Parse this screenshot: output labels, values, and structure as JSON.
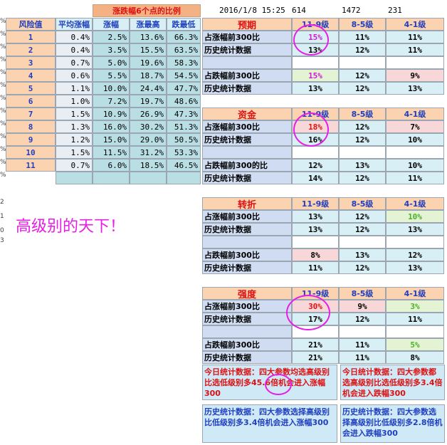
{
  "top_banner": "涨跌幅6个点的比例",
  "timestamp": "2016/1/8  15:25",
  "top_values": [
    "614",
    "1472",
    "231"
  ],
  "left_table": {
    "headers": [
      "风险值",
      "平均涨幅",
      "涨幅",
      "涨最高",
      "跌最低"
    ],
    "rows": [
      [
        "1",
        "0.4%",
        "2.5%",
        "13.6%",
        "66.3%"
      ],
      [
        "2",
        "0.4%",
        "3.5%",
        "15.5%",
        "63.5%"
      ],
      [
        "3",
        "0.7%",
        "5.0%",
        "19.6%",
        "58.3%"
      ],
      [
        "4",
        "0.6%",
        "5.5%",
        "18.7%",
        "54.5%"
      ],
      [
        "5",
        "1.1%",
        "10.0%",
        "24.4%",
        "47.7%"
      ],
      [
        "6",
        "1.0%",
        "7.2%",
        "19.7%",
        "48.6%"
      ],
      [
        "7",
        "1.5%",
        "10.9%",
        "26.9%",
        "47.3%"
      ],
      [
        "8",
        "1.3%",
        "16.0%",
        "30.2%",
        "51.3%"
      ],
      [
        "9",
        "1.2%",
        "15.0%",
        "29.0%",
        "50.5%"
      ],
      [
        "10",
        "1.5%",
        "11.5%",
        "31.2%",
        "53.3%"
      ],
      [
        "11",
        "0.7%",
        "6.0%",
        "18.5%",
        "46.5%"
      ]
    ]
  },
  "annotation": "高级别的天下！",
  "level_headers": [
    "11-9级",
    "8-5级",
    "4-1级"
  ],
  "sections": [
    {
      "title": "预期",
      "rows": [
        {
          "label": "占涨幅前300比",
          "v": [
            "15%",
            "11%",
            "11%"
          ]
        },
        {
          "label": "历史统计数据",
          "v": [
            "13%",
            "12%",
            "11%"
          ]
        },
        {
          "label": "",
          "v": [
            "",
            "",
            ""
          ]
        },
        {
          "label": "占跌幅前300比",
          "v": [
            "15%",
            "12%",
            "9%"
          ]
        },
        {
          "label": "历史统计数据",
          "v": [
            "13%",
            "12%",
            "13%"
          ]
        }
      ]
    },
    {
      "title": "资金",
      "rows": [
        {
          "label": "占涨幅前300比",
          "v": [
            "18%",
            "12%",
            "7%"
          ]
        },
        {
          "label": "历史统计数据",
          "v": [
            "16%",
            "12%",
            "10%"
          ]
        },
        {
          "label": "",
          "v": [
            "",
            "",
            ""
          ]
        },
        {
          "label": "占跌幅前300的比",
          "v": [
            "12%",
            "13%",
            "10%"
          ]
        },
        {
          "label": "历史统计数据",
          "v": [
            "14%",
            "12%",
            "11%"
          ]
        }
      ]
    },
    {
      "title": "转折",
      "rows": [
        {
          "label": "占涨幅前300比",
          "v": [
            "13%",
            "12%",
            "10%"
          ]
        },
        {
          "label": "历史统计数据",
          "v": [
            "13%",
            "12%",
            "13%"
          ]
        },
        {
          "label": "",
          "v": [
            "",
            "",
            ""
          ]
        },
        {
          "label": "占跌幅前300比",
          "v": [
            "8%",
            "13%",
            "12%"
          ]
        },
        {
          "label": "历史统计数据",
          "v": [
            "11%",
            "12%",
            "13%"
          ]
        }
      ]
    },
    {
      "title": "强度",
      "rows": [
        {
          "label": "占涨幅前300比",
          "v": [
            "30%",
            "9%",
            "3%"
          ]
        },
        {
          "label": "历史统计数据",
          "v": [
            "17%",
            "12%",
            "11%"
          ]
        },
        {
          "label": "",
          "v": [
            "",
            "",
            ""
          ]
        },
        {
          "label": "占跌幅前300比",
          "v": [
            "21%",
            "11%",
            "5%"
          ]
        },
        {
          "label": "历史统计数据",
          "v": [
            "21%",
            "11%",
            "8%"
          ]
        }
      ]
    }
  ],
  "notes": {
    "today_left": "今日统计数据：四大参数均选高级别比选低级别多45.6倍机会进入涨幅300",
    "today_right": "今日统计数据：四大参数都选高级别比选低级别多3.4倍机会进入跌幅300",
    "hist_left": "历史统计数据：四大参数选择高级别比低级别多3.4倍机会进入涨幅300",
    "hist_right": "历史统计数据：四大参数选择高级别比低级别多2.8倍机会进入跌幅300"
  },
  "row_numbers": [
    "%",
    "%",
    "%",
    "%",
    "%",
    "%",
    "%",
    "%",
    "%",
    "%",
    "%",
    "%",
    "%",
    "2",
    "1",
    "0",
    "3"
  ],
  "colors": {
    "orange": "#fbd3b0",
    "teal": "#b9dfe5",
    "cyan_hdr": "#d8f0f5",
    "blue_label": "#cfdcf1",
    "pink": "#f7d7d7",
    "green_light": "#e3f3d4",
    "sky": "#cfe9f7",
    "magenta": "#e61ee6"
  }
}
